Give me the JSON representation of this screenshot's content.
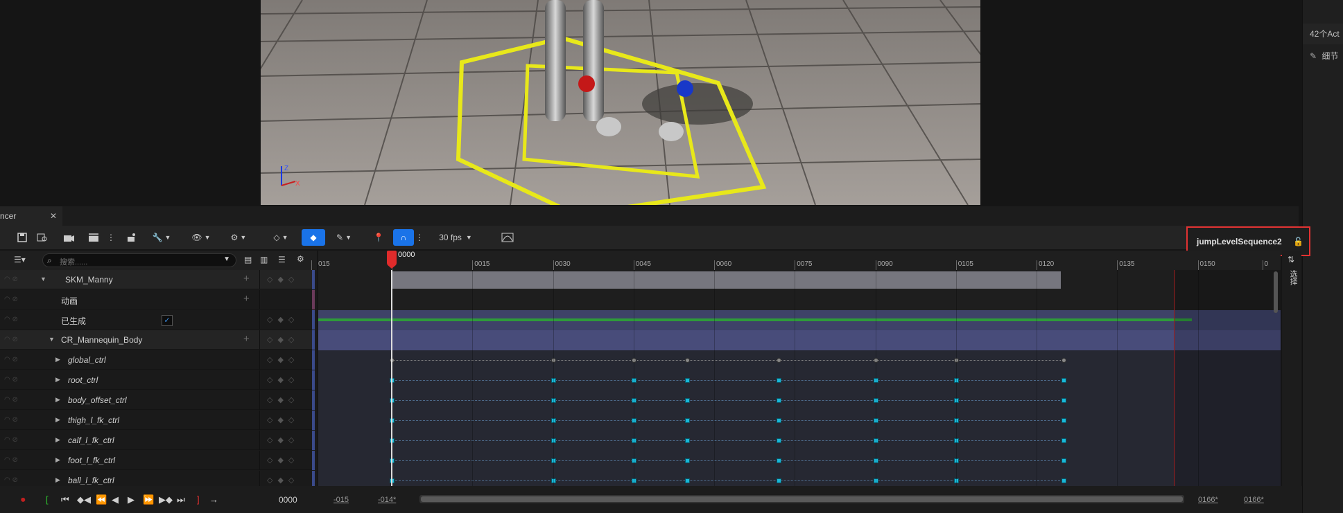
{
  "viewport": {
    "axis_labels": {
      "z": "Z",
      "x": "X"
    }
  },
  "right_panel": {
    "tab_actors": "42个Act",
    "tab_details": "细节",
    "vertical_label": "选择"
  },
  "sequencer": {
    "tab_label": "ncer",
    "fps": "30 fps",
    "sequence_name": "jumpLevelSequence2",
    "search_placeholder": "搜索......",
    "playhead_frame": "0000",
    "ruler_ticks": [
      "015",
      "0000",
      "0015",
      "0030",
      "0045",
      "0060",
      "0075",
      "0090",
      "0105",
      "0120",
      "0135",
      "0150",
      "0"
    ],
    "tracks": [
      {
        "name": "SKM_Manny",
        "italic": false,
        "indent": 1
      },
      {
        "name": "动画",
        "italic": false,
        "indent": 2
      },
      {
        "name": "已生成",
        "italic": false,
        "indent": 2
      },
      {
        "name": "CR_Mannequin_Body",
        "italic": false,
        "indent": 1
      },
      {
        "name": "global_ctrl",
        "italic": true,
        "indent": 3
      },
      {
        "name": "root_ctrl",
        "italic": true,
        "indent": 3
      },
      {
        "name": "body_offset_ctrl",
        "italic": true,
        "indent": 3
      },
      {
        "name": "thigh_l_fk_ctrl",
        "italic": true,
        "indent": 3
      },
      {
        "name": "calf_l_fk_ctrl",
        "italic": true,
        "indent": 3
      },
      {
        "name": "foot_l_fk_ctrl",
        "italic": true,
        "indent": 3
      },
      {
        "name": "ball_l_fk_ctrl",
        "italic": true,
        "indent": 3
      }
    ],
    "keyframes": [
      0,
      30,
      45,
      55,
      72,
      90,
      105,
      125
    ],
    "transport": {
      "current_frame": "0000",
      "range_start": "-015",
      "view_start": "-014*",
      "view_end": "0166*",
      "range_end": "0166*"
    },
    "colors": {
      "accent": "#1a73e8",
      "key": "#19b8d8",
      "highlight": "#e23232"
    }
  }
}
